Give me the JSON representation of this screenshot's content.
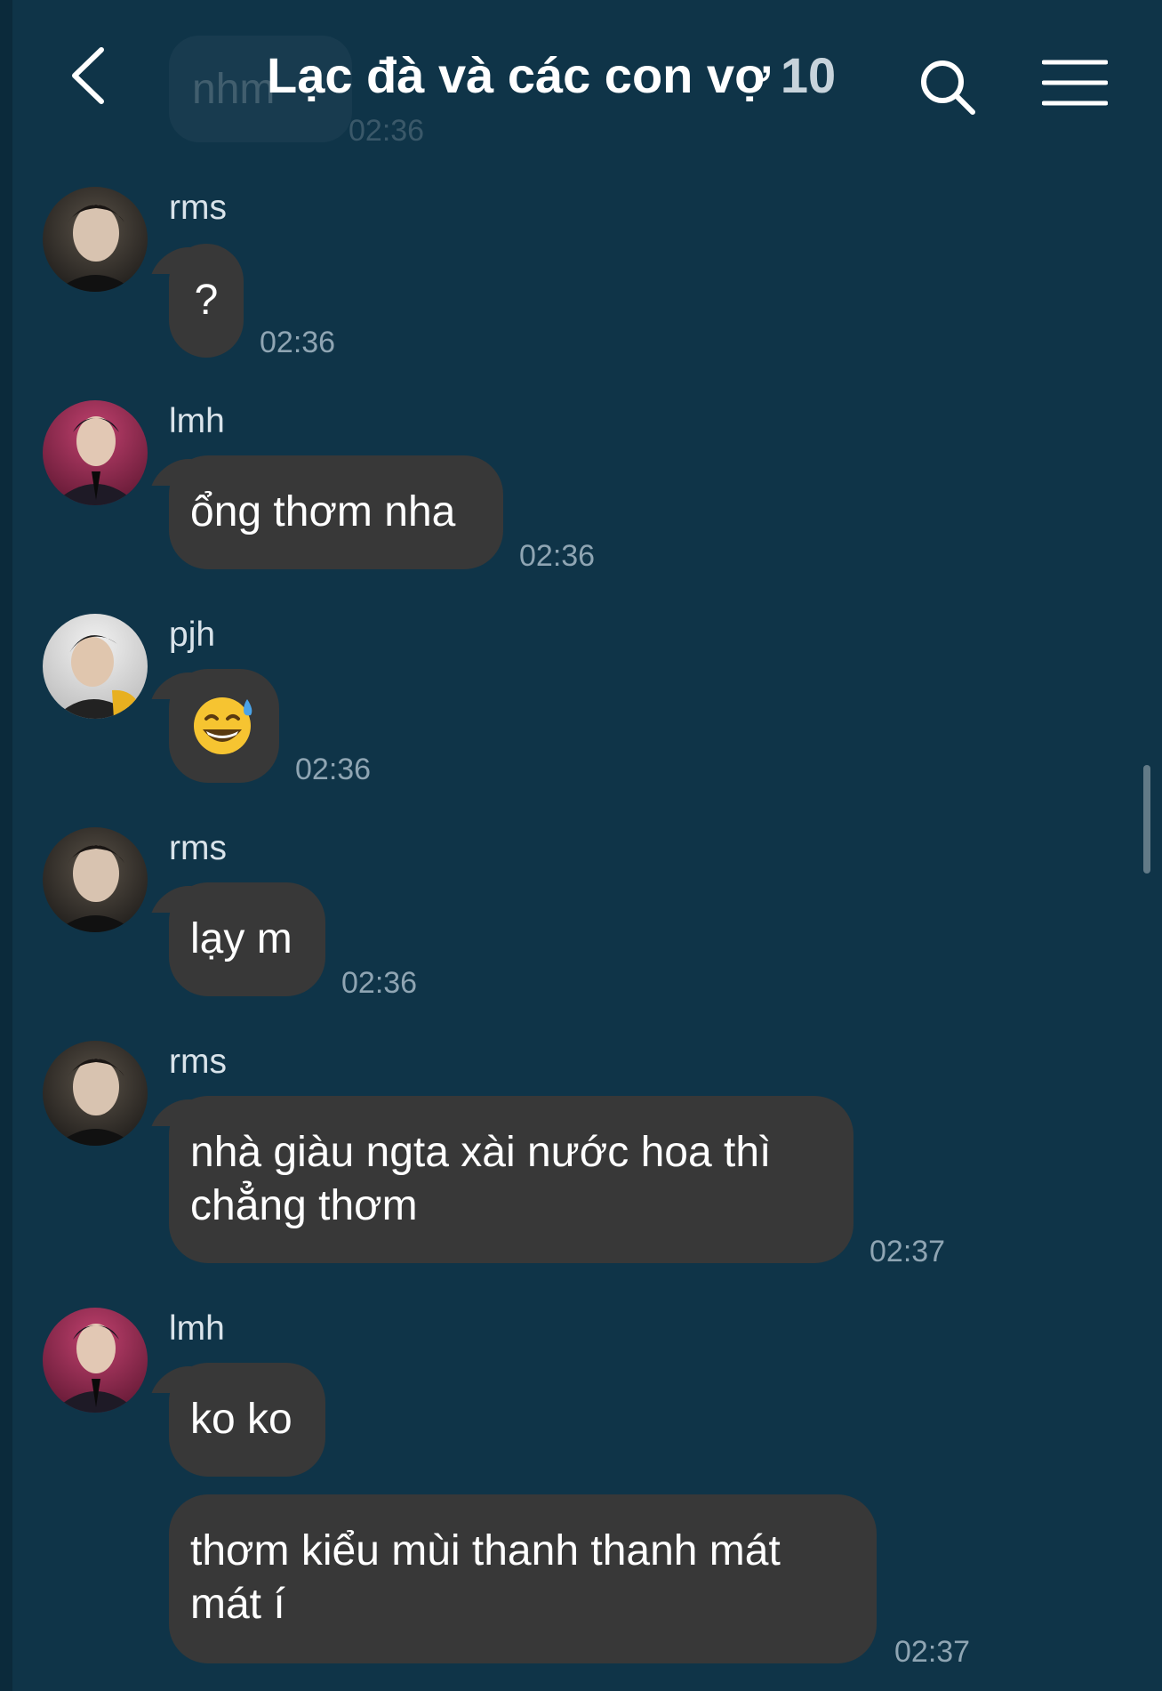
{
  "header": {
    "ghost_text": "nhm",
    "ghost_time": "02:36",
    "title": "Lạc đà và các con vợ",
    "member_count": "10"
  },
  "messages": [
    {
      "sender": "rms",
      "text": "?",
      "time": "02:36"
    },
    {
      "sender": "lmh",
      "text": "ổng thơm nha",
      "time": "02:36"
    },
    {
      "sender": "pjh",
      "text": "😅",
      "time": "02:36"
    },
    {
      "sender": "rms",
      "text": "lạy m",
      "time": "02:36"
    },
    {
      "sender": "rms",
      "text": "nhà giàu ngta xài nước hoa thì chẳng thơm",
      "time": "02:37"
    },
    {
      "sender": "lmh",
      "text": "ko ko",
      "time": ""
    },
    {
      "sender": "",
      "text": "thơm kiểu mùi thanh thanh mát mát í",
      "time": "02:37"
    }
  ],
  "icons": {
    "back": "chevron-left-icon",
    "search": "search-icon",
    "menu": "hamburger-menu-icon"
  },
  "colors": {
    "background": "#0f3448",
    "bubble": "#383838",
    "timestamp": "#8fa5b3"
  }
}
